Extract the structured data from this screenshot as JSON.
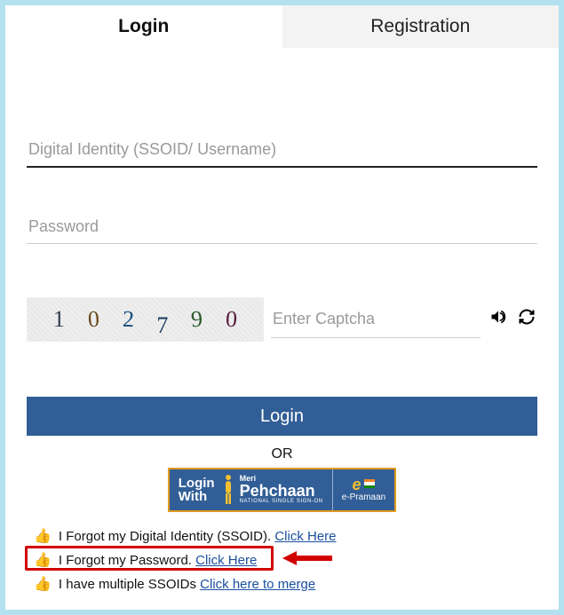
{
  "tabs": {
    "login": "Login",
    "registration": "Registration"
  },
  "fields": {
    "ssoid_placeholder": "Digital Identity (SSOID/ Username)",
    "password_placeholder": "Password",
    "captcha_placeholder": "Enter Captcha"
  },
  "captcha": {
    "d1": "1",
    "d2": "0",
    "d3": "2",
    "d4": "7",
    "d5": "9",
    "d6": "0"
  },
  "buttons": {
    "login": "Login",
    "or": "OR"
  },
  "pehchaan": {
    "login": "Login",
    "with": "With",
    "meri": "Meri",
    "brand": "Pehchaan",
    "sub": "NATIONAL SINGLE SIGN-ON",
    "ep": "e-Pramaan"
  },
  "links": {
    "forgot_id_text": "I Forgot my Digital Identity (SSOID). ",
    "forgot_id_link": "Click Here",
    "forgot_pw_text": "I Forgot my Password. ",
    "forgot_pw_link": "Click Here",
    "multi_text": "I have multiple SSOIDs ",
    "multi_link": "Click here to merge"
  },
  "icons": {
    "audio": "captcha-audio-icon",
    "refresh": "captcha-refresh-icon"
  }
}
